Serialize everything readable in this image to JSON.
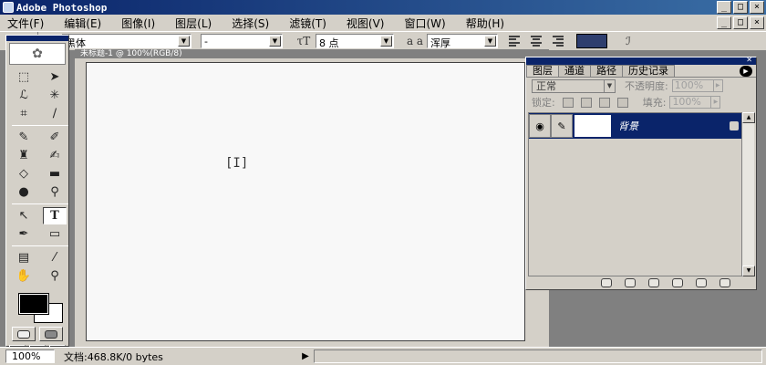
{
  "window": {
    "title": "Adobe Photoshop",
    "controls": {
      "minimize": "_",
      "maximize": "□",
      "close": "×"
    }
  },
  "menubar": {
    "items": [
      {
        "label": "文件(F)"
      },
      {
        "label": "编辑(E)"
      },
      {
        "label": "图像(I)"
      },
      {
        "label": "图层(L)"
      },
      {
        "label": "选择(S)"
      },
      {
        "label": "滤镜(T)"
      },
      {
        "label": "视图(V)"
      },
      {
        "label": "窗口(W)"
      },
      {
        "label": "帮助(H)"
      }
    ]
  },
  "options": {
    "tool_preset_glyph": "T",
    "orientation_glyph": "↨T",
    "font_family": "黑体",
    "font_style": "-",
    "font_size_glyph": "τT",
    "font_size": "8 点",
    "antialias_glyph": "a a",
    "antialias": "浑厚",
    "text_color": "#2e3e6e",
    "warp_glyph": "ℐ"
  },
  "toolbox": {
    "active_tool": "type-tool",
    "fg_color": "#000000",
    "bg_color": "#ffffff"
  },
  "document": {
    "title": "未标题-1 @ 100%(RGB/8)",
    "cursor_glyph": "[I]"
  },
  "layers_panel": {
    "tabs": [
      {
        "label": "图层",
        "active": true
      },
      {
        "label": "通道",
        "active": false
      },
      {
        "label": "路径",
        "active": false
      },
      {
        "label": "历史记录",
        "active": false
      }
    ],
    "blend_mode": "正常",
    "opacity_label": "不透明度:",
    "opacity_value": "100%",
    "lock_label": "锁定:",
    "fill_label": "填充:",
    "fill_value": "100%",
    "layers": [
      {
        "name": "背景",
        "visible": true,
        "locked": true
      }
    ]
  },
  "statusbar": {
    "zoom": "100%",
    "doc_info": "文档:468.8K/0 bytes",
    "arrow": "▶"
  }
}
